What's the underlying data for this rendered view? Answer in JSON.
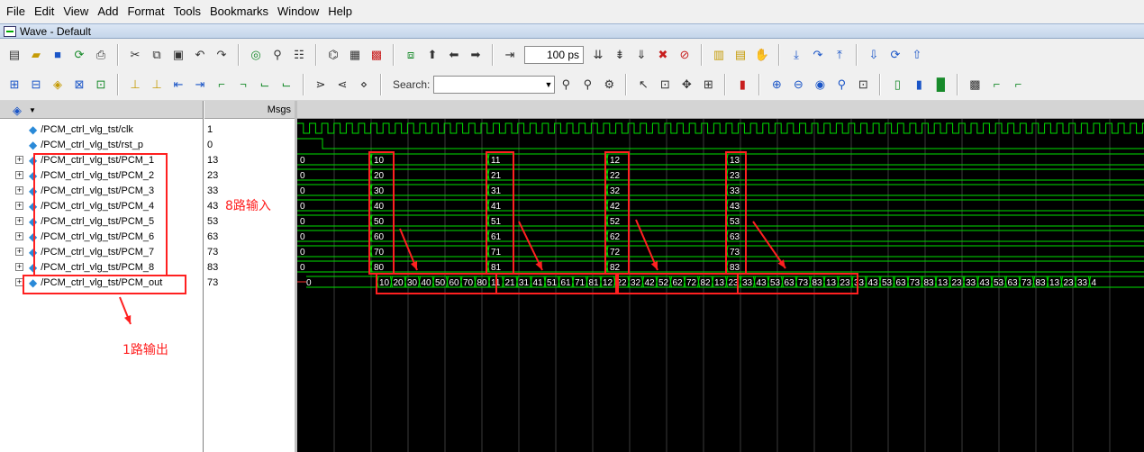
{
  "menu": {
    "items": [
      "File",
      "Edit",
      "View",
      "Add",
      "Format",
      "Tools",
      "Bookmarks",
      "Window",
      "Help"
    ]
  },
  "window": {
    "title": "Wave - Default"
  },
  "toolbar": {
    "zoom_value": "100 ps",
    "search_label": "Search:",
    "search_value": ""
  },
  "panes": {
    "msgs_header": "Msgs"
  },
  "signals": [
    {
      "name": "/PCM_ctrl_vlg_tst/clk",
      "value": "1",
      "expandable": false
    },
    {
      "name": "/PCM_ctrl_vlg_tst/rst_p",
      "value": "0",
      "expandable": false
    },
    {
      "name": "/PCM_ctrl_vlg_tst/PCM_1",
      "value": "13",
      "expandable": true
    },
    {
      "name": "/PCM_ctrl_vlg_tst/PCM_2",
      "value": "23",
      "expandable": true
    },
    {
      "name": "/PCM_ctrl_vlg_tst/PCM_3",
      "value": "33",
      "expandable": true
    },
    {
      "name": "/PCM_ctrl_vlg_tst/PCM_4",
      "value": "43",
      "expandable": true
    },
    {
      "name": "/PCM_ctrl_vlg_tst/PCM_5",
      "value": "53",
      "expandable": true
    },
    {
      "name": "/PCM_ctrl_vlg_tst/PCM_6",
      "value": "63",
      "expandable": true
    },
    {
      "name": "/PCM_ctrl_vlg_tst/PCM_7",
      "value": "73",
      "expandable": true
    },
    {
      "name": "/PCM_ctrl_vlg_tst/PCM_8",
      "value": "83",
      "expandable": true
    },
    {
      "name": "/PCM_ctrl_vlg_tst/PCM_out",
      "value": "73",
      "expandable": true
    }
  ],
  "wave": {
    "bus_segments": [
      [
        "0",
        "10",
        "11",
        "12",
        "13"
      ],
      [
        "0",
        "20",
        "21",
        "22",
        "23"
      ],
      [
        "0",
        "30",
        "31",
        "32",
        "33"
      ],
      [
        "0",
        "40",
        "41",
        "42",
        "43"
      ],
      [
        "0",
        "50",
        "51",
        "52",
        "53"
      ],
      [
        "0",
        "60",
        "61",
        "62",
        "63"
      ],
      [
        "0",
        "70",
        "71",
        "72",
        "73"
      ],
      [
        "0",
        "80",
        "81",
        "82",
        "83"
      ]
    ],
    "out_sequence": [
      "0",
      "10",
      "20",
      "30",
      "40",
      "50",
      "60",
      "70",
      "80",
      "11",
      "21",
      "31",
      "41",
      "51",
      "61",
      "71",
      "81",
      "12",
      "22",
      "32",
      "42",
      "52",
      "62",
      "72",
      "82",
      "13",
      "23",
      "33",
      "43",
      "53",
      "63",
      "73",
      "83",
      "13",
      "23",
      "33",
      "43",
      "53",
      "63",
      "73",
      "83",
      "13",
      "23",
      "33",
      "43",
      "53",
      "63",
      "73",
      "83",
      "13",
      "23",
      "33",
      "4"
    ]
  },
  "annotations": {
    "inputs_label": "8路输入",
    "output_label": "1路输出"
  },
  "colors": {
    "wave_green": "#00e000",
    "bus_text": "#ffffff",
    "annotation_red": "#ff2020",
    "background": "#000000"
  }
}
